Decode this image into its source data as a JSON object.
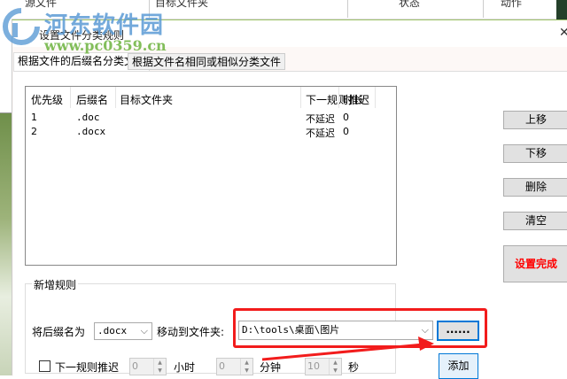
{
  "background_window": {
    "columns": [
      "源文件",
      "目标文件夹",
      "状态",
      "动作"
    ]
  },
  "watermark": {
    "name": "河东软件园",
    "url": "www.pc0359.cn"
  },
  "dialog": {
    "title": "设置文件分类规则",
    "close_icon": "close-icon",
    "tabs": [
      {
        "label": "根据文件的后缀名分类文件",
        "active": true
      },
      {
        "label": "根据文件名相同或相似分类文件",
        "active": false
      }
    ],
    "rules_table": {
      "headers": [
        "优先级",
        "后缀名",
        "目标文件夹",
        "下一规则推迟",
        "时长"
      ],
      "rows": [
        [
          "1",
          ".doc",
          "",
          "不延迟",
          "0"
        ],
        [
          "2",
          ".docx",
          "",
          "不延迟",
          "0"
        ]
      ]
    },
    "side_buttons": {
      "up": "上移",
      "down": "下移",
      "delete": "删除",
      "clear": "清空",
      "done": "设置完成"
    },
    "new_rule": {
      "group_label": "新增规则",
      "ext_label": "将后缀名为",
      "ext_value": ".docx",
      "folder_label": "移动到文件夹:",
      "folder_value": "D:\\tools\\桌面\\图片",
      "browse_label": "......",
      "delay_label": "下一规则推迟",
      "delay_checked": false,
      "hours_value": "0",
      "hours_label": "小时",
      "minutes_value": "0",
      "minutes_label": "分钟",
      "seconds_value": "10",
      "seconds_label": "秒",
      "add_label": "添加"
    },
    "colors": {
      "done_text": "#ff0000",
      "highlight": "#f21c1c",
      "focus": "#0078d7"
    }
  }
}
